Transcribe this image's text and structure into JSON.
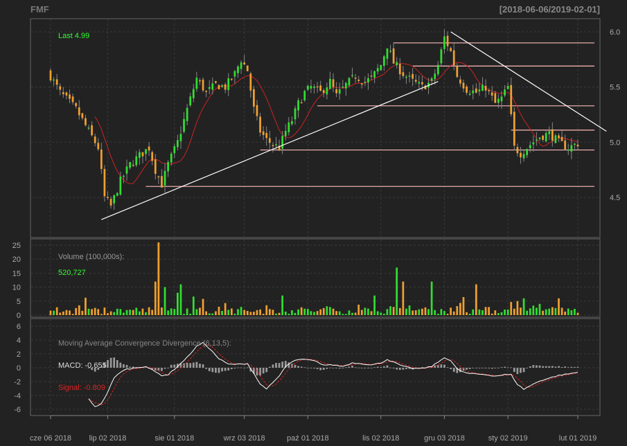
{
  "header": {
    "symbol": "FMF",
    "date_range": "[2018-06-06/2019-02-01]"
  },
  "colors": {
    "background": "#222222",
    "panel_border": "#666666",
    "grid": "#3a3a3a",
    "text": "#aaaaaa",
    "up": "#33dd33",
    "down": "#f0a030",
    "ma": "#cc2222",
    "trendline": "#ffffff",
    "level_line": "#ffbbbb",
    "macd_line": "#ffffff",
    "signal_line": "#dd2222",
    "histogram": "#999999",
    "last_label": "#33ff33"
  },
  "chart_data": [
    {
      "type": "candlestick",
      "panel": "price",
      "last_label": "Last 4.99",
      "ylim": [
        4.25,
        6.05
      ],
      "y_ticks": [
        4.5,
        5.0,
        5.5,
        6.0
      ],
      "y_tick_labels": [
        "4.5",
        "5.0",
        "5.5",
        "6.0"
      ],
      "x_tick_labels": [
        "cze 06 2018",
        "lip 02 2018",
        "sie 01 2018",
        "wrz 03 2018",
        "paź 01 2018",
        "lis 02 2018",
        "gru 03 2018",
        "sty 02 2019",
        "lut 01 2019"
      ],
      "x_tick_index": [
        0,
        18,
        39,
        61,
        81,
        104,
        124,
        144,
        166
      ],
      "n_bars": 167,
      "close_anchors": [
        [
          0,
          5.6
        ],
        [
          3,
          5.45
        ],
        [
          8,
          5.3
        ],
        [
          12,
          5.1
        ],
        [
          15,
          4.95
        ],
        [
          17,
          4.5
        ],
        [
          19,
          4.42
        ],
        [
          22,
          4.65
        ],
        [
          25,
          4.8
        ],
        [
          28,
          4.88
        ],
        [
          31,
          4.95
        ],
        [
          33,
          4.75
        ],
        [
          35,
          4.62
        ],
        [
          37,
          4.8
        ],
        [
          40,
          5.0
        ],
        [
          43,
          5.3
        ],
        [
          46,
          5.58
        ],
        [
          49,
          5.45
        ],
        [
          52,
          5.52
        ],
        [
          55,
          5.5
        ],
        [
          58,
          5.62
        ],
        [
          60,
          5.75
        ],
        [
          62,
          5.65
        ],
        [
          64,
          5.3
        ],
        [
          66,
          5.1
        ],
        [
          68,
          5.02
        ],
        [
          70,
          4.98
        ],
        [
          72,
          4.95
        ],
        [
          74,
          5.1
        ],
        [
          76,
          5.2
        ],
        [
          78,
          5.35
        ],
        [
          80,
          5.45
        ],
        [
          82,
          5.5
        ],
        [
          85,
          5.45
        ],
        [
          88,
          5.55
        ],
        [
          90,
          5.42
        ],
        [
          93,
          5.52
        ],
        [
          96,
          5.6
        ],
        [
          99,
          5.55
        ],
        [
          101,
          5.58
        ],
        [
          104,
          5.7
        ],
        [
          106,
          5.88
        ],
        [
          108,
          5.72
        ],
        [
          111,
          5.62
        ],
        [
          114,
          5.55
        ],
        [
          117,
          5.5
        ],
        [
          120,
          5.55
        ],
        [
          122,
          5.7
        ],
        [
          124,
          5.95
        ],
        [
          126,
          5.82
        ],
        [
          128,
          5.6
        ],
        [
          131,
          5.48
        ],
        [
          134,
          5.45
        ],
        [
          137,
          5.5
        ],
        [
          140,
          5.35
        ],
        [
          142,
          5.4
        ],
        [
          144,
          5.5
        ],
        [
          146,
          4.95
        ],
        [
          148,
          4.9
        ],
        [
          151,
          4.98
        ],
        [
          154,
          5.05
        ],
        [
          157,
          5.08
        ],
        [
          160,
          5.0
        ],
        [
          163,
          4.95
        ],
        [
          166,
          4.99
        ]
      ],
      "moving_average": {
        "color": "#cc2222"
      },
      "trendlines": [
        {
          "from": [
            16,
            4.3
          ],
          "to": [
            122,
            5.55
          ]
        },
        {
          "from": [
            126,
            6.0
          ],
          "to": [
            175,
            5.1
          ]
        }
      ],
      "levels": [
        {
          "value": 5.9,
          "from": 108,
          "to": 175
        },
        {
          "value": 5.69,
          "from": 114,
          "to": 175
        },
        {
          "value": 5.33,
          "from": 84,
          "to": 175
        },
        {
          "value": 5.11,
          "from": 145,
          "to": 175
        },
        {
          "value": 4.93,
          "from": 66,
          "to": 175
        },
        {
          "value": 4.6,
          "from": 30,
          "to": 175
        }
      ]
    },
    {
      "type": "bar",
      "panel": "volume",
      "title": "Volume (100,000s):",
      "last_value": "520,727",
      "ylim": [
        0,
        26
      ],
      "y_ticks": [
        0,
        5,
        10,
        15,
        20,
        25
      ],
      "y_tick_labels": [
        "0",
        "5",
        "10",
        "15",
        "20",
        "25"
      ],
      "spikes": [
        [
          33,
          12
        ],
        [
          34,
          26
        ],
        [
          36,
          10
        ],
        [
          40,
          8
        ],
        [
          41,
          11
        ],
        [
          73,
          7
        ],
        [
          102,
          7
        ],
        [
          109,
          17
        ],
        [
          111,
          12
        ],
        [
          120,
          12
        ],
        [
          134,
          11
        ],
        [
          149,
          6
        ],
        [
          160,
          6
        ]
      ]
    },
    {
      "type": "line",
      "panel": "macd",
      "title": "Moving Average Convergence Divergence (6,13,5):",
      "macd_label": "MACD: -0.655",
      "signal_label": "Signal: -0.809",
      "ylim": [
        -6.5,
        6.5
      ],
      "y_ticks": [
        -6,
        -4,
        -2,
        0,
        2,
        4,
        6
      ],
      "y_tick_labels": [
        "-6",
        "-4",
        "-2",
        "0",
        "2",
        "4",
        "6"
      ],
      "macd_anchors": [
        [
          12,
          -4.5
        ],
        [
          14,
          -5.6
        ],
        [
          16,
          -5.2
        ],
        [
          18,
          -3.5
        ],
        [
          20,
          -1.5
        ],
        [
          22,
          -0.6
        ],
        [
          24,
          -0.2
        ],
        [
          27,
          0.0
        ],
        [
          30,
          0.2
        ],
        [
          33,
          -0.6
        ],
        [
          35,
          -1.1
        ],
        [
          37,
          -1.0
        ],
        [
          40,
          0.2
        ],
        [
          43,
          1.5
        ],
        [
          46,
          3.1
        ],
        [
          48,
          3.6
        ],
        [
          50,
          2.8
        ],
        [
          53,
          1.3
        ],
        [
          56,
          0.5
        ],
        [
          59,
          0.5
        ],
        [
          62,
          0.6
        ],
        [
          64,
          -0.8
        ],
        [
          66,
          -2.4
        ],
        [
          68,
          -3.0
        ],
        [
          70,
          -2.2
        ],
        [
          72,
          -1.2
        ],
        [
          74,
          0.2
        ],
        [
          77,
          1.1
        ],
        [
          80,
          1.2
        ],
        [
          83,
          1.0
        ],
        [
          86,
          0.4
        ],
        [
          89,
          0.4
        ],
        [
          92,
          0.2
        ],
        [
          95,
          0.7
        ],
        [
          98,
          0.6
        ],
        [
          101,
          0.4
        ],
        [
          104,
          0.7
        ],
        [
          106,
          1.2
        ],
        [
          108,
          0.8
        ],
        [
          111,
          0.2
        ],
        [
          114,
          -0.1
        ],
        [
          117,
          -0.1
        ],
        [
          120,
          0.2
        ],
        [
          122,
          0.8
        ],
        [
          124,
          1.5
        ],
        [
          126,
          1.0
        ],
        [
          128,
          -0.2
        ],
        [
          131,
          -0.8
        ],
        [
          134,
          -0.9
        ],
        [
          137,
          -1.0
        ],
        [
          140,
          -1.2
        ],
        [
          143,
          -1.0
        ],
        [
          145,
          -1.0
        ],
        [
          147,
          -2.4
        ],
        [
          149,
          -3.1
        ],
        [
          151,
          -2.6
        ],
        [
          154,
          -1.9
        ],
        [
          157,
          -1.5
        ],
        [
          160,
          -1.1
        ],
        [
          163,
          -0.9
        ],
        [
          166,
          -0.655
        ]
      ],
      "signal_lag": 2
    }
  ]
}
